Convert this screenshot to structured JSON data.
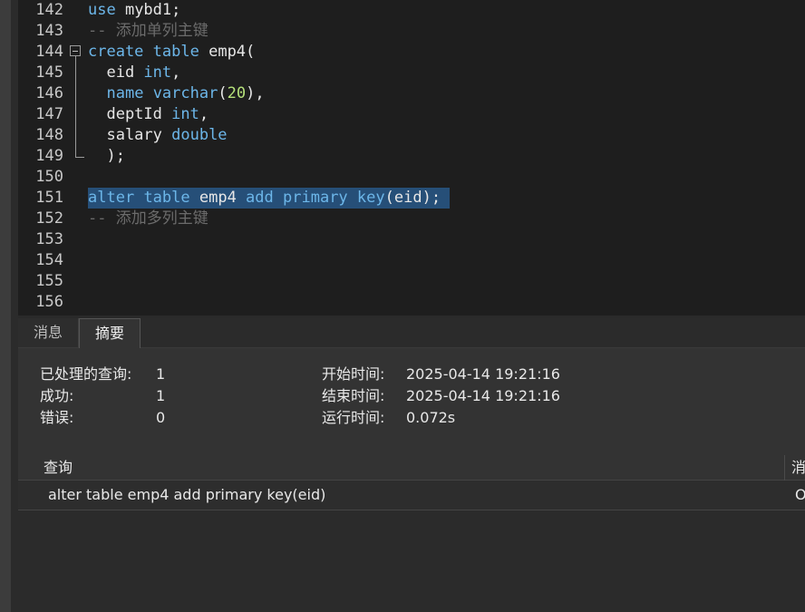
{
  "editor": {
    "lines": [
      {
        "n": "142",
        "tokens": [
          [
            "kw",
            "use"
          ],
          [
            "t",
            " mybd1;"
          ]
        ]
      },
      {
        "n": "143",
        "tokens": [
          [
            "cmt",
            "-- 添加单列主键"
          ]
        ]
      },
      {
        "n": "144",
        "tokens": [
          [
            "kw",
            "create"
          ],
          [
            "t",
            " "
          ],
          [
            "kw",
            "table"
          ],
          [
            "t",
            " emp4("
          ]
        ]
      },
      {
        "n": "145",
        "tokens": [
          [
            "t",
            "  eid "
          ],
          [
            "kw",
            "int"
          ],
          [
            "t",
            ","
          ]
        ]
      },
      {
        "n": "146",
        "tokens": [
          [
            "t",
            "  "
          ],
          [
            "kw",
            "name"
          ],
          [
            "t",
            " "
          ],
          [
            "kw",
            "varchar"
          ],
          [
            "t",
            "("
          ],
          [
            "num",
            "20"
          ],
          [
            "t",
            "),"
          ]
        ]
      },
      {
        "n": "147",
        "tokens": [
          [
            "t",
            "  deptId "
          ],
          [
            "kw",
            "int"
          ],
          [
            "t",
            ","
          ]
        ]
      },
      {
        "n": "148",
        "tokens": [
          [
            "t",
            "  salary "
          ],
          [
            "kw",
            "double"
          ]
        ]
      },
      {
        "n": "149",
        "tokens": [
          [
            "t",
            "  );"
          ]
        ]
      },
      {
        "n": "150",
        "tokens": []
      },
      {
        "n": "151",
        "selected": true,
        "tokens": [
          [
            "kw",
            "alter"
          ],
          [
            "t",
            " "
          ],
          [
            "kw",
            "table"
          ],
          [
            "t",
            " emp4 "
          ],
          [
            "kw",
            "add"
          ],
          [
            "t",
            " "
          ],
          [
            "kw",
            "primary"
          ],
          [
            "t",
            " "
          ],
          [
            "kw",
            "key"
          ],
          [
            "t",
            "(eid); "
          ]
        ]
      },
      {
        "n": "152",
        "tokens": [
          [
            "cmt",
            "-- 添加多列主键"
          ]
        ]
      },
      {
        "n": "153",
        "tokens": []
      },
      {
        "n": "154",
        "tokens": []
      },
      {
        "n": "155",
        "tokens": []
      },
      {
        "n": "156",
        "tokens": []
      }
    ]
  },
  "tabs": {
    "messages": "消息",
    "summary": "摘要"
  },
  "summary": {
    "processed_label": "已处理的查询:",
    "processed_value": "1",
    "success_label": "成功:",
    "success_value": "1",
    "error_label": "错误:",
    "error_value": "0",
    "start_label": "开始时间:",
    "start_value": "2025-04-14 19:21:16",
    "end_label": "结束时间:",
    "end_value": "2025-04-14 19:21:16",
    "run_label": "运行时间:",
    "run_value": "0.072s"
  },
  "grid": {
    "col_query": "查询",
    "col_message": "消",
    "rows": [
      {
        "query": "alter table emp4 add primary key(eid)",
        "message": "O"
      }
    ]
  }
}
